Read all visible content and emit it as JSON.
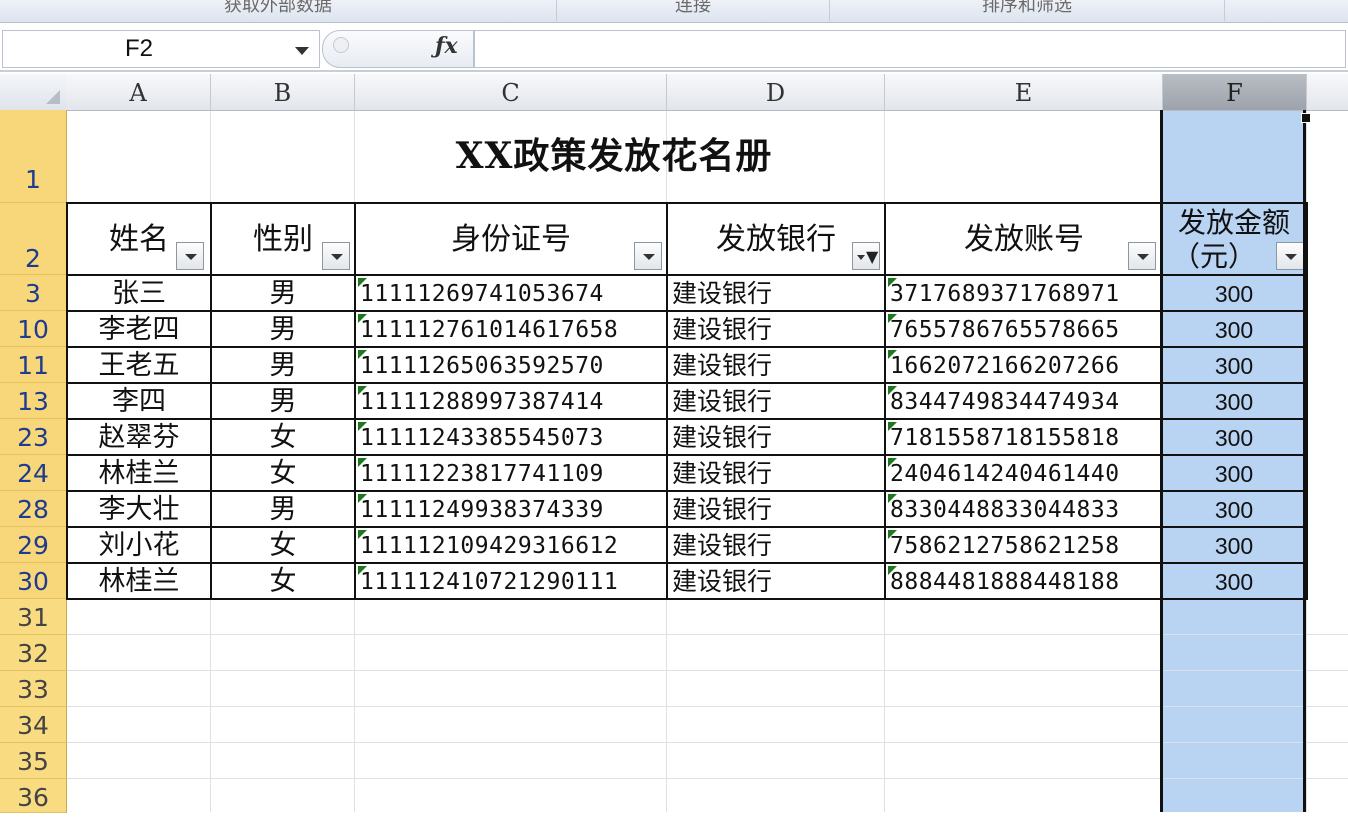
{
  "ribbon": {
    "groups": [
      "获取外部数据",
      "连接",
      "排序和筛选"
    ]
  },
  "formula_bar": {
    "cell_ref": "F2",
    "fx_label": "fx",
    "formula": ""
  },
  "columns": [
    "A",
    "B",
    "C",
    "D",
    "E",
    "F"
  ],
  "title": "XX政策发放花名册",
  "headers": {
    "name": "姓名",
    "gender": "性别",
    "id_number": "身份证号",
    "bank": "发放银行",
    "account": "发放账号",
    "amount_line1": "发放金额",
    "amount_line2": "（元）"
  },
  "row_numbers": [
    "1",
    "2",
    "3",
    "10",
    "11",
    "13",
    "23",
    "24",
    "28",
    "29",
    "30",
    "31",
    "32",
    "33",
    "34",
    "35",
    "36"
  ],
  "rows": [
    {
      "name": "张三",
      "gender": "男",
      "id": "111112697410536​74",
      "bank": "建设银行",
      "account": "3717689371768971",
      "amount": "300"
    },
    {
      "name": "李老四",
      "gender": "男",
      "id": "111112761014617658",
      "bank": "建设银行",
      "account": "7655786765578665",
      "amount": "300"
    },
    {
      "name": "王老五",
      "gender": "男",
      "id": "1111126506359257​0",
      "bank": "建设银行",
      "account": "1662072166207266",
      "amount": "300"
    },
    {
      "name": "李四",
      "gender": "男",
      "id": "11111288997387414",
      "bank": "建设银行",
      "account": "8344749834474934",
      "amount": "300"
    },
    {
      "name": "赵翠芬",
      "gender": "女",
      "id": "11111243385545073",
      "bank": "建设银行",
      "account": "7181558718155818",
      "amount": "300"
    },
    {
      "name": "林桂兰",
      "gender": "女",
      "id": "11111223817741109",
      "bank": "建设银行",
      "account": "2404614240461440",
      "amount": "300"
    },
    {
      "name": "李大壮",
      "gender": "男",
      "id": "11111249938374339",
      "bank": "建设银行",
      "account": "8330448833044833",
      "amount": "300"
    },
    {
      "name": "刘小花",
      "gender": "女",
      "id": "111112109429316612",
      "bank": "建设银行",
      "account": "7586212758621258",
      "amount": "300"
    },
    {
      "name": "林桂兰",
      "gender": "女",
      "id": "111112410721290111",
      "bank": "建设银行",
      "account": "8884481888448188",
      "amount": "300"
    }
  ]
}
